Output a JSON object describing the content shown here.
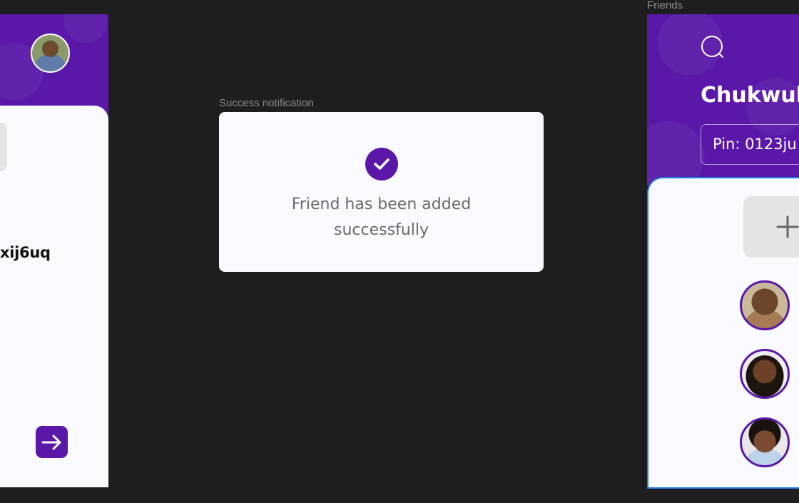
{
  "left_frame": {
    "pin_text": "xij6uq"
  },
  "notification": {
    "frame_label": "Success notification",
    "message": "Friend has been added successfully"
  },
  "friends_frame": {
    "frame_label": "Friends",
    "name": "Chukwul",
    "pin": "Pin: 0123ju",
    "friends": [
      {
        "avatar": "friend-avatar-1"
      },
      {
        "avatar": "friend-avatar-2"
      },
      {
        "avatar": "friend-avatar-3"
      }
    ]
  },
  "colors": {
    "canvas": "#1e1e1e",
    "brand_purple": "#5a17a8",
    "card_bg": "#f9fafe",
    "selection_blue": "#1f7ae0",
    "muted_text": "#6a6a6a"
  },
  "icons": {
    "check": "check-circle-icon",
    "search": "search-icon",
    "add": "plus-icon",
    "next": "arrow-right-icon"
  }
}
